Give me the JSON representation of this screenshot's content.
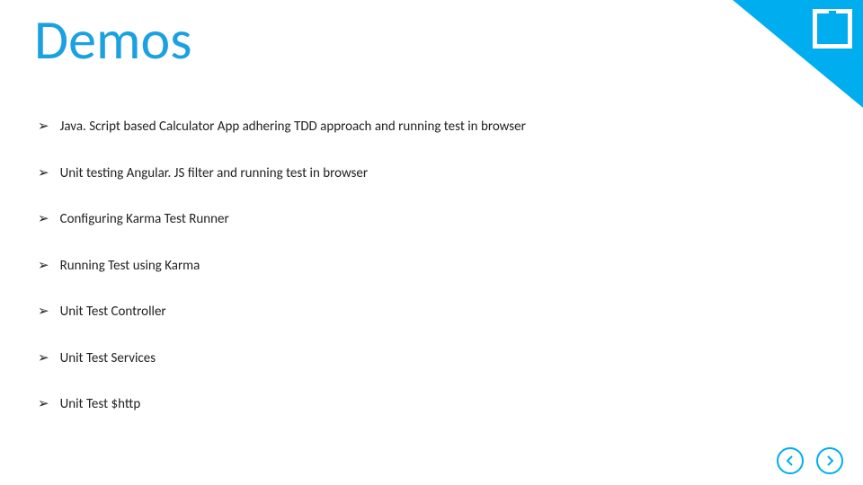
{
  "title": "Demos",
  "bullets": [
    "Java. Script based Calculator App adhering TDD approach and running test in browser",
    "Unit testing Angular. JS filter and running test in browser",
    "Configuring Karma Test Runner",
    "Running Test using Karma",
    "Unit Test Controller",
    "Unit Test Services",
    "Unit Test $http"
  ],
  "colors": {
    "accent": "#00aeef",
    "titleColor": "#1ba1e2"
  }
}
